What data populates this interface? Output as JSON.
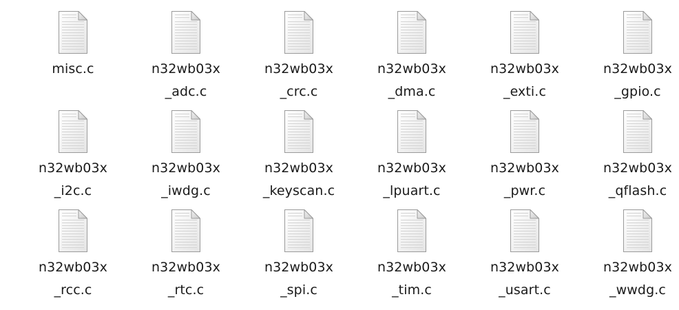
{
  "files": [
    {
      "line1": "misc.c",
      "line2": "",
      "icon": "text-file-icon"
    },
    {
      "line1": "n32wb03x",
      "line2": "_adc.c",
      "icon": "text-file-icon"
    },
    {
      "line1": "n32wb03x",
      "line2": "_crc.c",
      "icon": "text-file-icon"
    },
    {
      "line1": "n32wb03x",
      "line2": "_dma.c",
      "icon": "text-file-icon"
    },
    {
      "line1": "n32wb03x",
      "line2": "_exti.c",
      "icon": "text-file-icon"
    },
    {
      "line1": "n32wb03x",
      "line2": "_gpio.c",
      "icon": "text-file-icon"
    },
    {
      "line1": "n32wb03x",
      "line2": "_i2c.c",
      "icon": "text-file-icon"
    },
    {
      "line1": "n32wb03x",
      "line2": "_iwdg.c",
      "icon": "text-file-icon"
    },
    {
      "line1": "n32wb03x",
      "line2": "_keyscan.c",
      "icon": "text-file-icon"
    },
    {
      "line1": "n32wb03x",
      "line2": "_lpuart.c",
      "icon": "text-file-icon"
    },
    {
      "line1": "n32wb03x",
      "line2": "_pwr.c",
      "icon": "text-file-icon"
    },
    {
      "line1": "n32wb03x",
      "line2": "_qflash.c",
      "icon": "text-file-icon"
    },
    {
      "line1": "n32wb03x",
      "line2": "_rcc.c",
      "icon": "text-file-icon"
    },
    {
      "line1": "n32wb03x",
      "line2": "_rtc.c",
      "icon": "text-file-icon"
    },
    {
      "line1": "n32wb03x",
      "line2": "_spi.c",
      "icon": "text-file-icon"
    },
    {
      "line1": "n32wb03x",
      "line2": "_tim.c",
      "icon": "text-file-icon"
    },
    {
      "line1": "n32wb03x",
      "line2": "_usart.c",
      "icon": "text-file-icon"
    },
    {
      "line1": "n32wb03x",
      "line2": "_wwdg.c",
      "icon": "text-file-icon"
    }
  ]
}
